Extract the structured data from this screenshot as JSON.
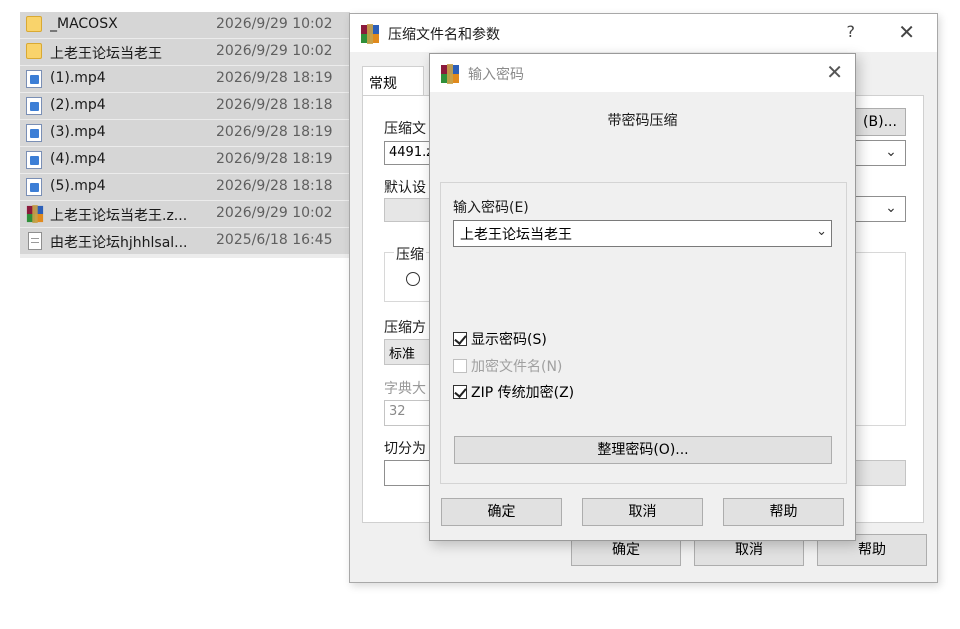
{
  "files": [
    {
      "name": "_MACOSX",
      "date": "2026/9/29 10:02",
      "icon": "folder-icon"
    },
    {
      "name": "上老王论坛当老王",
      "date": "2026/9/29 10:02",
      "icon": "folder-icon"
    },
    {
      "name": "(1).mp4",
      "date": "2026/9/28 18:19",
      "icon": "video-file-icon"
    },
    {
      "name": "(2).mp4",
      "date": "2026/9/28 18:18",
      "icon": "video-file-icon"
    },
    {
      "name": "(3).mp4",
      "date": "2026/9/28 18:19",
      "icon": "video-file-icon"
    },
    {
      "name": "(4).mp4",
      "date": "2026/9/28 18:19",
      "icon": "video-file-icon"
    },
    {
      "name": "(5).mp4",
      "date": "2026/9/28 18:18",
      "icon": "video-file-icon"
    },
    {
      "name": "上老王论坛当老王.z...",
      "date": "2026/9/29 10:02",
      "icon": "winrar-archive-icon"
    },
    {
      "name": "由老王论坛hjhhlsal...",
      "date": "2025/6/18 16:45",
      "icon": "text-file-icon"
    }
  ],
  "main_dialog": {
    "title": "压缩文件名和参数",
    "help_glyph": "?",
    "close_glyph": "✕",
    "tab_general": "常规",
    "archive_name_label": "压缩文",
    "archive_name_value": "4491.z",
    "browse_label": "(B)...",
    "default_profile_label": "默认设",
    "format_group_label": "压缩",
    "method_label": "压缩方",
    "method_value": "标准",
    "dict_label": "字典大",
    "dict_value": "32",
    "split_label": "切分为",
    "ok": "确定",
    "cancel": "取消",
    "help": "帮助"
  },
  "password_dialog": {
    "title": "输入密码",
    "close_glyph": "✕",
    "heading": "带密码压缩",
    "password_label": "输入密码(E)",
    "password_value": "上老王论坛当老王",
    "show_password": "显示密码(S)",
    "encrypt_filenames": "加密文件名(N)",
    "zip_legacy": "ZIP 传统加密(Z)",
    "organize_button": "整理密码(O)...",
    "ok": "确定",
    "cancel": "取消",
    "help": "帮助",
    "show_password_checked": true,
    "encrypt_filenames_checked": false,
    "zip_legacy_checked": true
  },
  "colors": {
    "selection": "#d6d6d6",
    "dialog_bg": "#f0f0f0",
    "button_bg": "#e1e1e1"
  }
}
